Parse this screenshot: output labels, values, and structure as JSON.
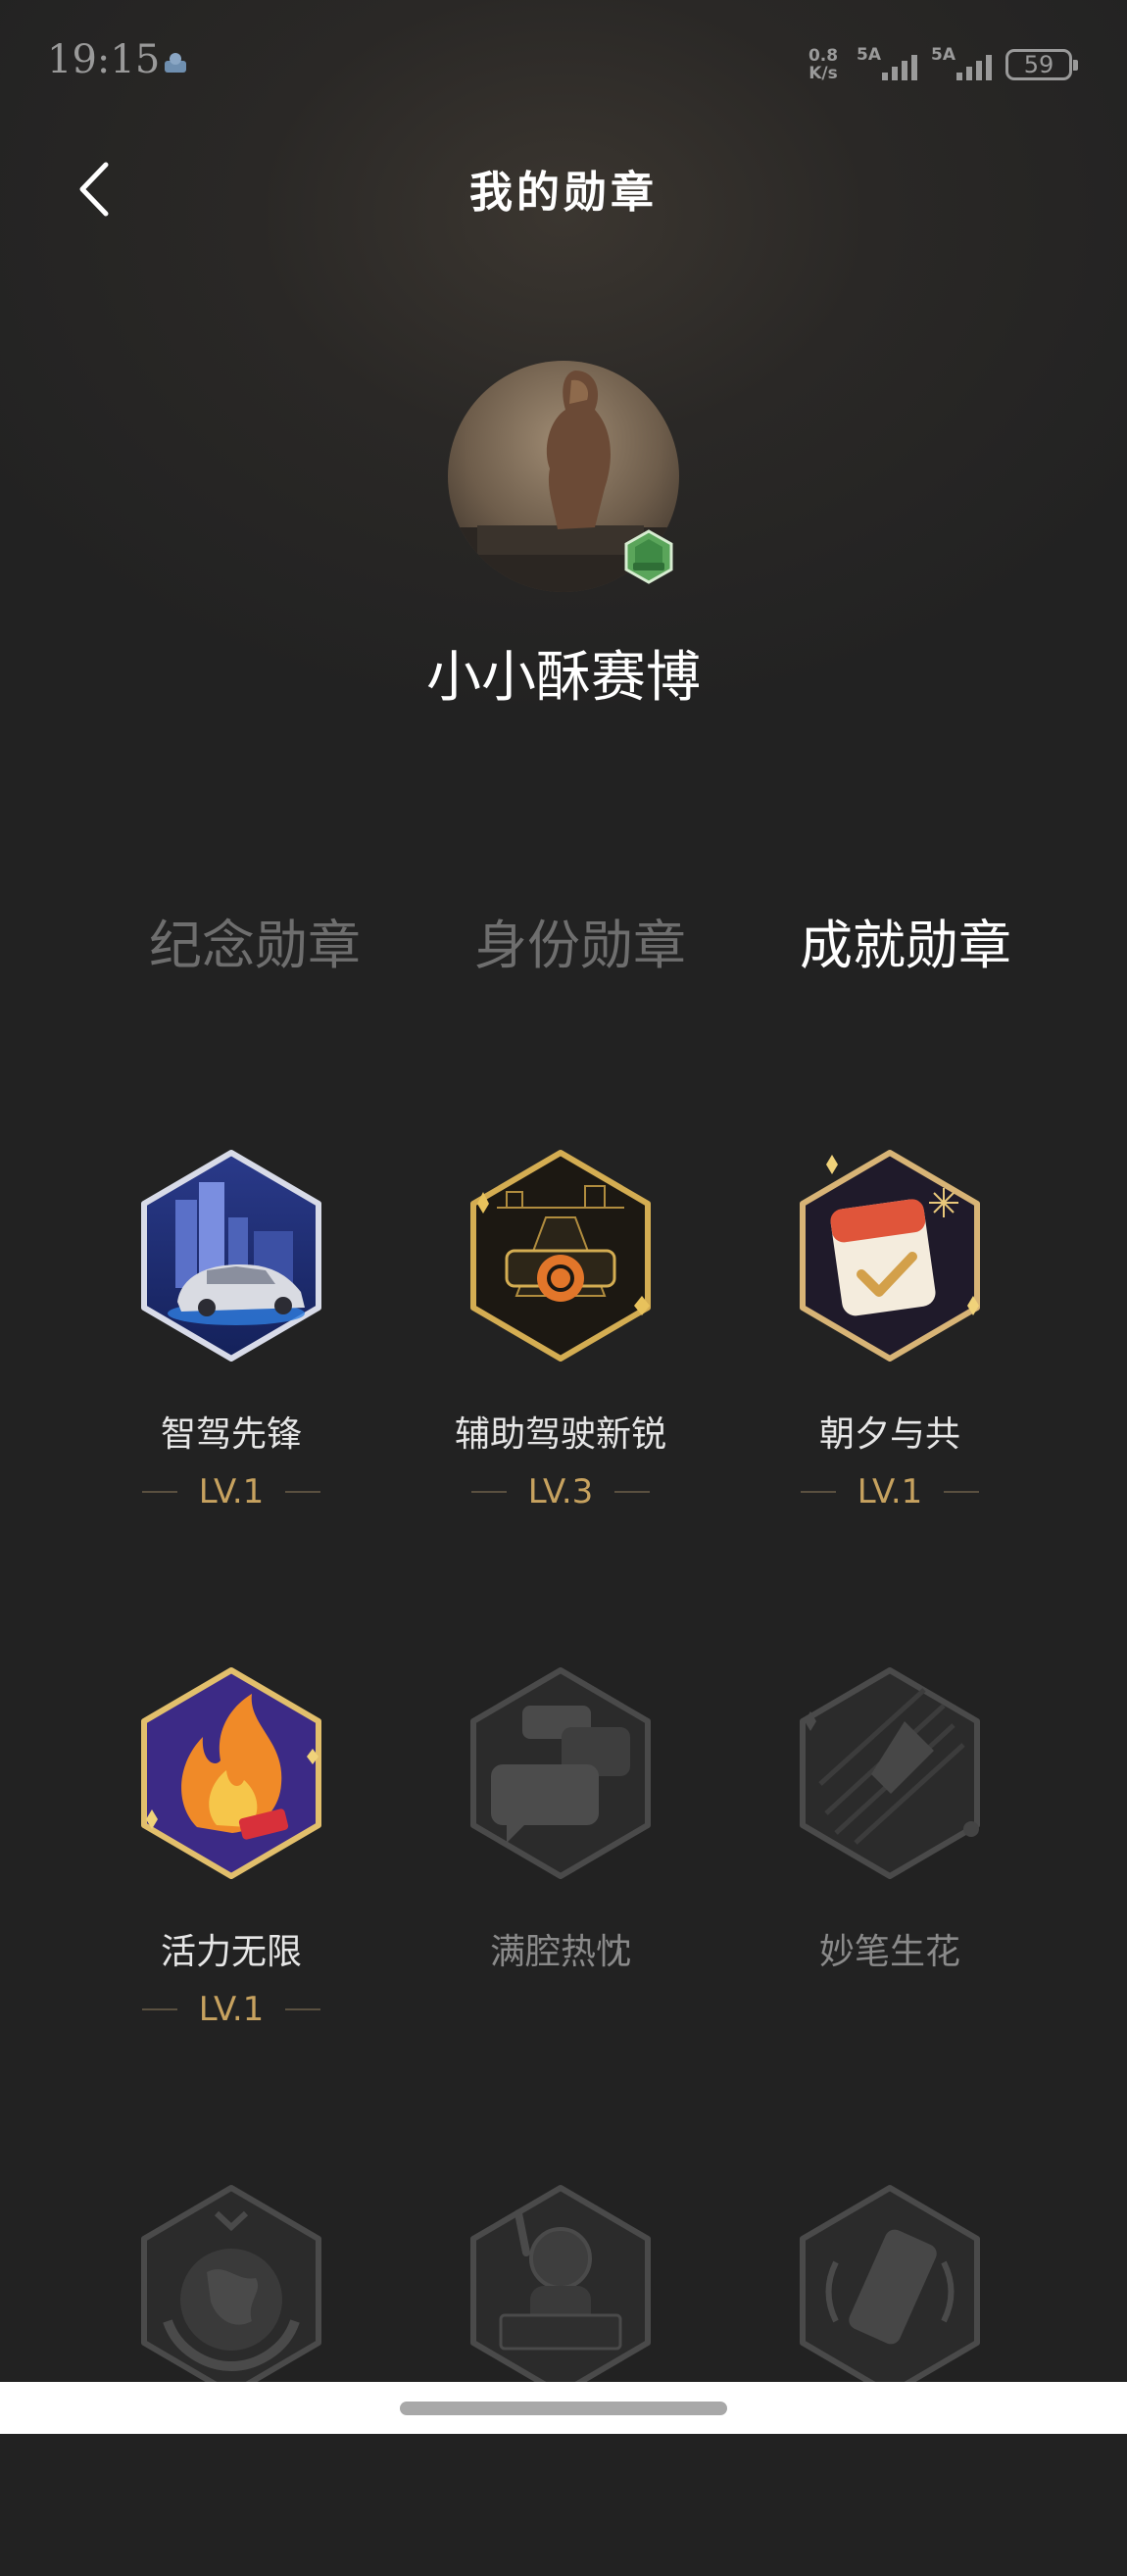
{
  "status_bar": {
    "time": "19:15",
    "net_speed_value": "0.8",
    "net_speed_unit": "K/s",
    "signal_1": "5A",
    "signal_2": "5A",
    "battery": "59"
  },
  "header": {
    "title": "我的勋章",
    "back_icon": "chevron-left-icon"
  },
  "profile": {
    "username": "小小酥赛博"
  },
  "tabs": [
    {
      "label": "纪念勋章",
      "active": false
    },
    {
      "label": "身份勋章",
      "active": false
    },
    {
      "label": "成就勋章",
      "active": true
    }
  ],
  "badges": [
    {
      "name": "智驾先锋",
      "level": "LV.1",
      "earned": true,
      "icon": "city-car-badge-icon"
    },
    {
      "name": "辅助驾驶新锐",
      "level": "LV.3",
      "earned": true,
      "icon": "steering-wheel-road-badge-icon"
    },
    {
      "name": "朝夕与共",
      "level": "LV.1",
      "earned": true,
      "icon": "calendar-check-badge-icon"
    },
    {
      "name": "活力无限",
      "level": "LV.1",
      "earned": true,
      "icon": "flame-badge-icon"
    },
    {
      "name": "满腔热忱",
      "earned": false,
      "icon": "chat-bubbles-badge-icon"
    },
    {
      "name": "妙笔生花",
      "earned": false,
      "icon": "pen-badge-icon"
    },
    {
      "earned": false,
      "icon": "globe-hands-badge-icon"
    },
    {
      "earned": false,
      "icon": "astronaut-hello-badge-icon"
    },
    {
      "earned": false,
      "icon": "phone-badge-icon"
    }
  ],
  "colors": {
    "background": "#222222",
    "level_gold": "#c7a25f",
    "tab_inactive": "#6e6e6e"
  },
  "avatar_badge_icon": "green-hexagon-level-icon"
}
